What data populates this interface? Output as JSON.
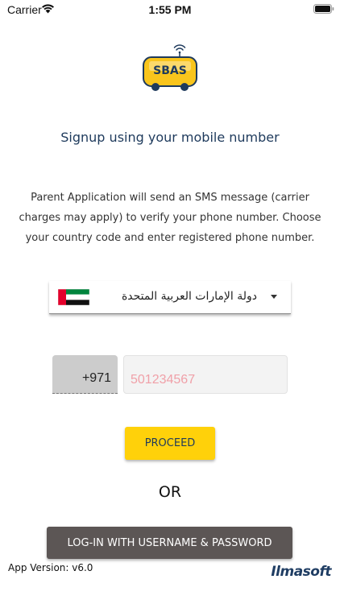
{
  "status_bar": {
    "carrier": "Carrier",
    "time": "1:55 PM"
  },
  "logo": {
    "text": "SBAS",
    "bus_color": "#f9c51c"
  },
  "signup": {
    "title": "Signup using your mobile number",
    "description": "Parent Application will send an SMS message (carrier charges may apply) to verify your phone number. Choose your country code and enter registered phone number."
  },
  "country_select": {
    "selected": "دولة الإمارات العربية المتحدة"
  },
  "phone": {
    "country_code": "+971",
    "placeholder": "501234567"
  },
  "buttons": {
    "proceed": "PROCEED",
    "or": "OR",
    "login": "LOG-IN WITH USERNAME & PASSWORD"
  },
  "footer": {
    "app_version": "App Version: v6.0",
    "brand": "Ilmasoft"
  },
  "colors": {
    "accent": "#ffd10a",
    "dark_button": "#5c5655",
    "title": "#1e3a5c",
    "placeholder": "#f0a0a8"
  }
}
